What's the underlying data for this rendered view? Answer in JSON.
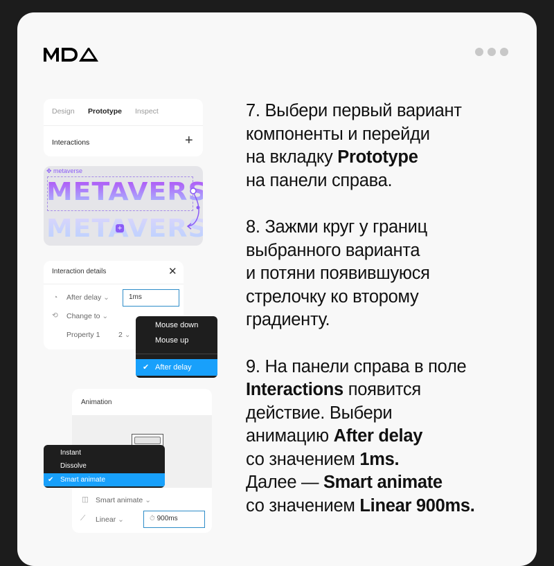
{
  "brand": {
    "logo": "MDA"
  },
  "menu_dots_icon": "more-horizontal-icon",
  "tabs_panel": {
    "tabs": [
      "Design",
      "Prototype",
      "Inspect"
    ],
    "active_tab": "Prototype",
    "section": "Interactions",
    "add_icon": "plus-icon"
  },
  "canvas": {
    "component_label": "metaverse",
    "word": "METAVERSE",
    "accent": "#8b5cf6"
  },
  "interaction_details": {
    "title": "Interaction details",
    "trigger": "After delay",
    "delay_value": "1ms",
    "action": "Change to",
    "property": "Property 1",
    "property_value": "2"
  },
  "trigger_menu": {
    "items": [
      "Mouse down",
      "Mouse up"
    ],
    "selected": "After delay"
  },
  "animation_panel": {
    "title": "Animation",
    "animation": "Smart animate",
    "easing": "Linear",
    "duration": "900ms"
  },
  "animation_menu": {
    "items": [
      "Instant",
      "Dissolve"
    ],
    "selected": "Smart animate"
  },
  "colors": {
    "highlight": "#18a0fb",
    "menu_bg": "#1e1e1e"
  },
  "instructions": [
    [
      [
        [
          "7. Выбери первый вариант",
          false
        ]
      ],
      [
        [
          "компоненты и перейди",
          false
        ]
      ],
      [
        [
          "на вкладку ",
          false
        ],
        [
          "Prototype",
          true
        ]
      ],
      [
        [
          "на панели справа.",
          false
        ]
      ]
    ],
    [
      [
        [
          "8. Зажми круг у границ",
          false
        ]
      ],
      [
        [
          "выбранного варианта",
          false
        ]
      ],
      [
        [
          "и потяни появившуюся",
          false
        ]
      ],
      [
        [
          "стрелочку ко второму",
          false
        ]
      ],
      [
        [
          "градиенту.",
          false
        ]
      ]
    ],
    [
      [
        [
          "9. На панели справа в поле",
          false
        ]
      ],
      [
        [
          "Interactions",
          true
        ],
        [
          " появится",
          false
        ]
      ],
      [
        [
          "действие. Выбери",
          false
        ]
      ],
      [
        [
          "анимацию ",
          false
        ],
        [
          "After delay",
          true
        ]
      ],
      [
        [
          "со значением ",
          false
        ],
        [
          "1ms.",
          true
        ]
      ],
      [
        [
          "Далее — ",
          false
        ],
        [
          "Smart animate",
          true
        ]
      ],
      [
        [
          "со значением ",
          false
        ],
        [
          "Linear 900ms.",
          true
        ]
      ]
    ]
  ]
}
